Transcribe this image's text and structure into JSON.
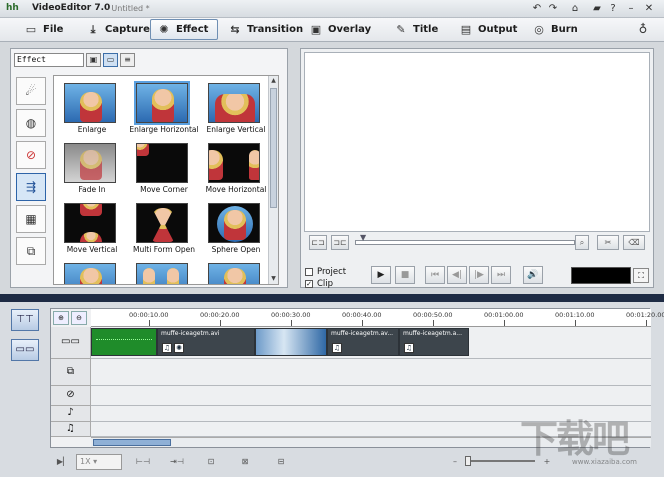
{
  "window": {
    "logo": "hh",
    "app_title": "VideoEditor 7.0",
    "doc_title": "- Untitled *"
  },
  "toolbar": {
    "items": [
      {
        "label": "File",
        "icon": "folder-icon"
      },
      {
        "label": "Capture",
        "icon": "capture-icon"
      },
      {
        "label": "Effect",
        "icon": "effect-icon",
        "active": true
      },
      {
        "label": "Transition",
        "icon": "transition-icon"
      },
      {
        "label": "Overlay",
        "icon": "overlay-icon"
      },
      {
        "label": "Title",
        "icon": "title-icon"
      },
      {
        "label": "Output",
        "icon": "output-icon"
      },
      {
        "label": "Burn",
        "icon": "disc-icon"
      }
    ]
  },
  "effect_panel": {
    "category_select": "Effect",
    "thumbnails": [
      {
        "label": "Enlarge"
      },
      {
        "label": "Enlarge Horizontal"
      },
      {
        "label": "Enlarge Vertical"
      },
      {
        "label": "Fade In"
      },
      {
        "label": "Move Corner"
      },
      {
        "label": "Move Horizontal"
      },
      {
        "label": "Move Vertical"
      },
      {
        "label": "Multi Form Open"
      },
      {
        "label": "Sphere Open"
      }
    ]
  },
  "preview": {
    "project_label": "Project",
    "clip_label": "Clip",
    "clip_checked": true
  },
  "timeline": {
    "ruler_ticks": [
      "00:00:10.00",
      "00:00:20.00",
      "00:00:30.00",
      "00:00:40.00",
      "00:00:50.00",
      "00:01:00.00",
      "00:01:10.00",
      "00:01:20.00"
    ],
    "clips": [
      {
        "name": "muffe-iceagetm.avi"
      },
      {
        "name": "muffe-iceagetm.av..."
      },
      {
        "name": "muffe-iceagetm.a..."
      }
    ],
    "speed": "1X"
  },
  "watermark": {
    "text": "下载吧",
    "url": "www.xiazaiba.com"
  }
}
